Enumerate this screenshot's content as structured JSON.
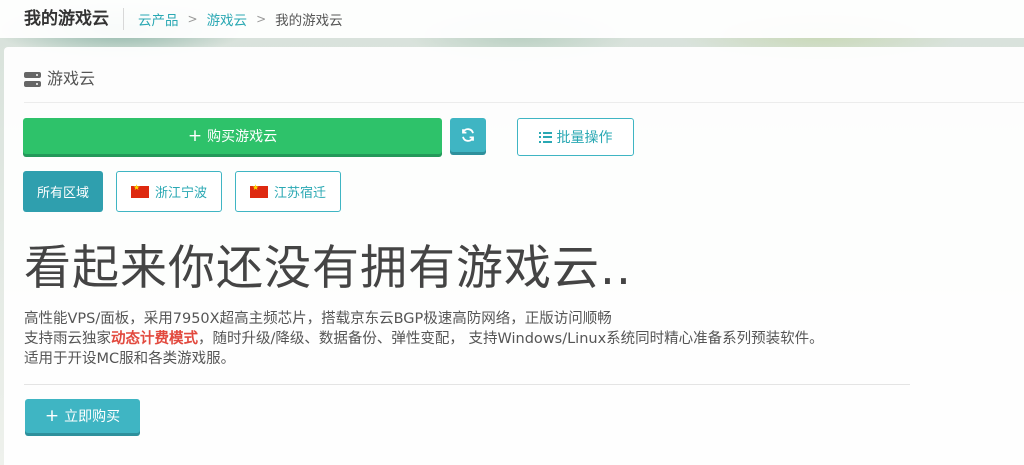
{
  "topbar": {
    "title": "我的游戏云",
    "breadcrumb": [
      "云产品",
      "游戏云",
      "我的游戏云"
    ]
  },
  "panel": {
    "title": "游戏云"
  },
  "toolbar": {
    "buy_label": "购买游戏云",
    "batch_label": "批量操作"
  },
  "regions": [
    {
      "label": "所有区域",
      "active": true
    },
    {
      "label": "浙江宁波",
      "flag": "cn-flag-icon"
    },
    {
      "label": "江苏宿迁",
      "flag": "cn-flag-icon"
    }
  ],
  "empty": {
    "headline": "看起来你还没有拥有游戏云..",
    "line1": "高性能VPS/面板，采用7950X超高主频芯片，搭载京东云BGP极速高防网络，正版访问顺畅",
    "line2_pre": "支持雨云独家",
    "line2_highlight": "动态计费模式",
    "line2_post": "，随时升级/降级、数据备份、弹性变配， 支持Windows/Linux系统同时精心准备系列预装软件。",
    "line3": "适用于开设MC服和各类游戏服。",
    "cta_label": "立即购买"
  },
  "colors": {
    "green": "#2ec26a",
    "teal": "#3fb5c3",
    "highlight": "#e2493e"
  }
}
